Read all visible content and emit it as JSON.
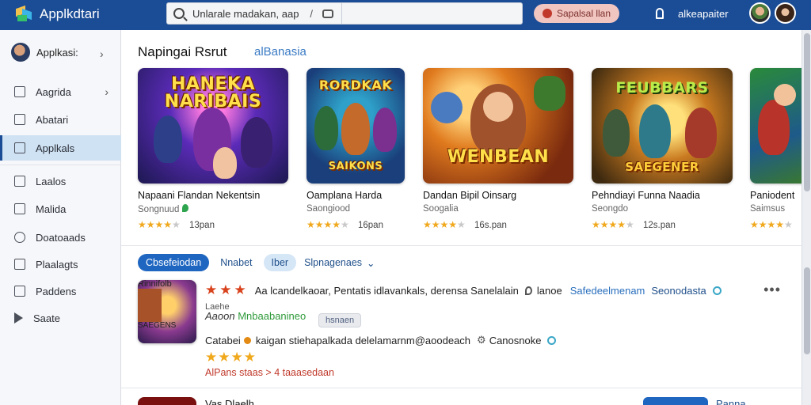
{
  "app": {
    "title": "Applkdtari"
  },
  "search": {
    "placeholder": "Unlarale madakan, aap",
    "edit_glyph": "/"
  },
  "header": {
    "pill_label": "Sapalsal llan",
    "user_name": "alkeapaiter"
  },
  "sidebar": {
    "account_label": "Applkasi:",
    "items": [
      {
        "label": "Aagrida",
        "has_chevron": true
      },
      {
        "label": "Abatari"
      },
      {
        "label": "Applkals",
        "active": true
      },
      {
        "label": "Laalos"
      },
      {
        "label": "Malida"
      },
      {
        "label": "Doatoaads"
      },
      {
        "label": "Plaalagts"
      },
      {
        "label": "Paddens"
      },
      {
        "label": "Saate"
      }
    ]
  },
  "section": {
    "title": "Napingai Rsrut",
    "link": "alBanasia"
  },
  "cards": [
    {
      "art_title": "HANEKA NARIBAIS",
      "art_sub": "",
      "name": "Napaani Flandan Nekentsin",
      "developer": "Songnuud",
      "rating": "13pan",
      "stars": 4
    },
    {
      "art_title": "RORDKAK",
      "art_sub": "SAIKONS",
      "name": "Oamplana Harda",
      "developer": "Saongiood",
      "rating": "16pan",
      "stars": 4
    },
    {
      "art_title": "WENBEAN",
      "art_sub": "",
      "name": "Dandan Bipil Oinsarg",
      "developer": "Soogalia",
      "rating": "16s.pan",
      "stars": 4
    },
    {
      "art_title": "FEUBBARS",
      "art_sub": "SAEGENER",
      "name": "Pehndiayi Funna Naadia",
      "developer": "Seongdo",
      "rating": "12s.pan",
      "stars": 4
    },
    {
      "art_title": "",
      "art_sub": "",
      "name": "Paniodent",
      "developer": "Saimsus",
      "rating": "",
      "stars": 4
    }
  ],
  "filters": {
    "primary": "Cbsefeiodan",
    "link": "Nnabet",
    "chip": "Iber",
    "sort": "Slpnagenaes"
  },
  "review": {
    "art_title": "Rinnifolb",
    "art_sub": "SAEGENS",
    "line1": "Aa lcandelkaoar, Pentatis idlavankals, derensa Sanelalain",
    "line1_extra": "lanoe",
    "tag1": "Safedeelmenam",
    "tag2": "Seonodasta",
    "line2": "Laehe",
    "line3_italic": "Aaoon",
    "line3_green": "Mnbaabanineo",
    "mini_chip": "hsnaen",
    "line4_prefix": "Catabei",
    "line4": "kaigan stiehapalkada delelamarnm@aoodeach",
    "line4_suffix": "Canosnoke",
    "stars": 4,
    "footer": "AlPans staas  >  4 taaasedaan"
  },
  "next_row": {
    "title": "Vas Dlaelh",
    "link": "Panna"
  },
  "colors": {
    "topbar": "#1b4d96",
    "accent": "#1f66c1",
    "star": "#f0a81c",
    "review_star": "#d8431d",
    "footer_red": "#c0392b",
    "active_nav_bg": "#cfe2f3"
  },
  "icons": {
    "brand": "stacked-cube-logo",
    "search": "search-icon",
    "edit": "edit-icon",
    "camera": "camera-icon",
    "bell": "bell-icon",
    "more": "more-icon"
  }
}
